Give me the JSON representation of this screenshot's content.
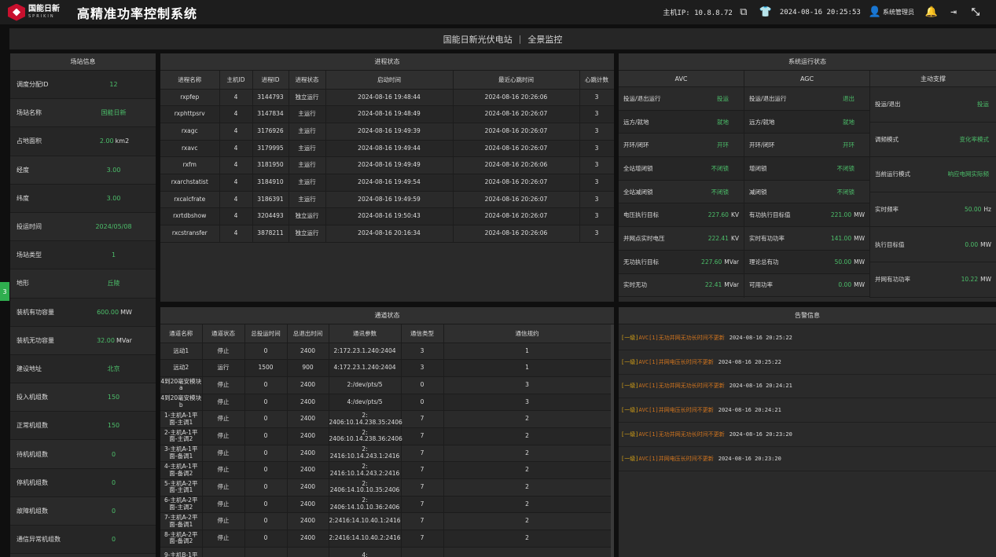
{
  "header": {
    "logo_cn": "国能日新",
    "logo_en": "SPRIKIN",
    "title": "高精准功率控制系统",
    "host_ip": "主机IP: 10.8.8.72",
    "datetime": "2024-08-16 20:25:53",
    "user": "系统管理员"
  },
  "station": {
    "name": "国能日新光伏电站",
    "view": "全景监控"
  },
  "side_tab": "3",
  "site_info": {
    "title": "场站信息",
    "rows": [
      {
        "k": "调度分配ID",
        "v": "12",
        "u": ""
      },
      {
        "k": "场站名称",
        "v": "国能日新",
        "u": ""
      },
      {
        "k": "占地面积",
        "v": "2.00",
        "u": "km2"
      },
      {
        "k": "经度",
        "v": "3.00",
        "u": ""
      },
      {
        "k": "纬度",
        "v": "3.00",
        "u": ""
      },
      {
        "k": "投运时间",
        "v": "2024/05/08",
        "u": ""
      },
      {
        "k": "场站类型",
        "v": "1",
        "u": ""
      },
      {
        "k": "地形",
        "v": "丘陵",
        "u": ""
      },
      {
        "k": "装机有功容量",
        "v": "600.00",
        "u": "MW"
      },
      {
        "k": "装机无功容量",
        "v": "32.00",
        "u": "MVar"
      },
      {
        "k": "建设地址",
        "v": "北京",
        "u": ""
      },
      {
        "k": "投入机组数",
        "v": "150",
        "u": ""
      },
      {
        "k": "正常机组数",
        "v": "150",
        "u": ""
      },
      {
        "k": "待机机组数",
        "v": "0",
        "u": ""
      },
      {
        "k": "停机机组数",
        "v": "0",
        "u": ""
      },
      {
        "k": "故障机组数",
        "v": "0",
        "u": ""
      },
      {
        "k": "通信异常机组数",
        "v": "0",
        "u": ""
      }
    ]
  },
  "process": {
    "title": "进程状态",
    "headers": [
      "进程名称",
      "主机ID",
      "进程ID",
      "进程状态",
      "启动时间",
      "最近心跳时间",
      "心跳计数"
    ],
    "rows": [
      [
        "rxpfep",
        "4",
        "3144793",
        "独立运行",
        "2024-08-16 19:48:44",
        "2024-08-16 20:26:06",
        "3"
      ],
      [
        "rxphttpsrv",
        "4",
        "3147834",
        "主运行",
        "2024-08-16 19:48:49",
        "2024-08-16 20:26:07",
        "3"
      ],
      [
        "rxagc",
        "4",
        "3176926",
        "主运行",
        "2024-08-16 19:49:39",
        "2024-08-16 20:26:07",
        "3"
      ],
      [
        "rxavc",
        "4",
        "3179995",
        "主运行",
        "2024-08-16 19:49:44",
        "2024-08-16 20:26:07",
        "3"
      ],
      [
        "rxfm",
        "4",
        "3181950",
        "主运行",
        "2024-08-16 19:49:49",
        "2024-08-16 20:26:06",
        "3"
      ],
      [
        "rxarchstatist",
        "4",
        "3184910",
        "主运行",
        "2024-08-16 19:49:54",
        "2024-08-16 20:26:07",
        "3"
      ],
      [
        "rxcalcfrate",
        "4",
        "3186391",
        "主运行",
        "2024-08-16 19:49:59",
        "2024-08-16 20:26:07",
        "3"
      ],
      [
        "rxrtdbshow",
        "4",
        "3204493",
        "独立运行",
        "2024-08-16 19:50:43",
        "2024-08-16 20:26:07",
        "3"
      ],
      [
        "rxcstransfer",
        "4",
        "3878211",
        "独立运行",
        "2024-08-16 20:16:34",
        "2024-08-16 20:26:06",
        "3"
      ]
    ]
  },
  "channel": {
    "title": "通道状态",
    "headers": [
      "通道名称",
      "通道状态",
      "总投运时间",
      "总退出时间",
      "通讯参数",
      "通信类型",
      "通信规约"
    ],
    "rows": [
      [
        "远动1",
        "停止",
        "0",
        "2400",
        "2:172.23.1.240:2404",
        "3",
        "1"
      ],
      [
        "远动2",
        "运行",
        "1500",
        "900",
        "4:172.23.1.240:2404",
        "3",
        "1"
      ],
      [
        "4到20毫安模块a",
        "停止",
        "0",
        "2400",
        "2:/dev/pts/5",
        "0",
        "3"
      ],
      [
        "4到20毫安模块b",
        "停止",
        "0",
        "2400",
        "4:/dev/pts/5",
        "0",
        "3"
      ],
      [
        "1-主机A-1平面-主调1",
        "停止",
        "0",
        "2400",
        "2: 2406:10.14.238.35:2406",
        "7",
        "2"
      ],
      [
        "2-主机A-1平面-主调2",
        "停止",
        "0",
        "2400",
        "2: 2406:10.14.238.36:2406",
        "7",
        "2"
      ],
      [
        "3-主机A-1平面-备调1",
        "停止",
        "0",
        "2400",
        "2: 2416:10.14.243.1:2416",
        "7",
        "2"
      ],
      [
        "4-主机A-1平面-备调2",
        "停止",
        "0",
        "2400",
        "2: 2416:10.14.243.2:2416",
        "7",
        "2"
      ],
      [
        "5-主机A-2平面-主调1",
        "停止",
        "0",
        "2400",
        "2: 2406:14.10.10.35:2406",
        "7",
        "2"
      ],
      [
        "6-主机A-2平面-主调2",
        "停止",
        "0",
        "2400",
        "2: 2406:14.10.10.36:2406",
        "7",
        "2"
      ],
      [
        "7-主机A-2平面-备调1",
        "停止",
        "0",
        "2400",
        "2:2416:14.10.40.1:2416",
        "7",
        "2"
      ],
      [
        "8-主机A-2平面-备调2",
        "停止",
        "0",
        "2400",
        "2:2416:14.10.40.2:2416",
        "7",
        "2"
      ],
      [
        "9-主机B-1平",
        "",
        "",
        "",
        "4:",
        "",
        ""
      ]
    ]
  },
  "sys_status": {
    "title": "系统运行状态",
    "avc": {
      "label": "AVC",
      "rows": [
        {
          "k": "投运/退出运行",
          "v": "投运",
          "u": ""
        },
        {
          "k": "远方/就地",
          "v": "就地",
          "u": ""
        },
        {
          "k": "开环/闭环",
          "v": "开环",
          "u": ""
        },
        {
          "k": "全站增闭锁",
          "v": "不闭锁",
          "u": ""
        },
        {
          "k": "全站减闭锁",
          "v": "不闭锁",
          "u": ""
        },
        {
          "k": "电压执行目标",
          "v": "227.60",
          "u": "KV"
        },
        {
          "k": "并网点实时电压",
          "v": "222.41",
          "u": "KV"
        },
        {
          "k": "无功执行目标",
          "v": "227.60",
          "u": "MVar"
        },
        {
          "k": "实时无功",
          "v": "22.41",
          "u": "MVar"
        }
      ]
    },
    "agc": {
      "label": "AGC",
      "rows": [
        {
          "k": "投运/退出运行",
          "v": "退出",
          "u": ""
        },
        {
          "k": "远方/就地",
          "v": "就地",
          "u": ""
        },
        {
          "k": "开环/闭环",
          "v": "开环",
          "u": ""
        },
        {
          "k": "增闭锁",
          "v": "不闭锁",
          "u": ""
        },
        {
          "k": "减闭锁",
          "v": "不闭锁",
          "u": ""
        },
        {
          "k": "有功执行目标值",
          "v": "221.00",
          "u": "MW"
        },
        {
          "k": "实时有功功率",
          "v": "141.00",
          "u": "MW"
        },
        {
          "k": "理论总有功",
          "v": "50.00",
          "u": "MW"
        },
        {
          "k": "可用功率",
          "v": "0.00",
          "u": "MW"
        }
      ]
    },
    "active": {
      "label": "主动支撑",
      "rows": [
        {
          "k": "投运/退出",
          "v": "投运",
          "u": ""
        },
        {
          "k": "调频模式",
          "v": "变化率模式",
          "u": ""
        },
        {
          "k": "当前运行模式",
          "v": "响应电网实际频",
          "u": ""
        },
        {
          "k": "实时频率",
          "v": "50.00",
          "u": "Hz"
        },
        {
          "k": "执行目标值",
          "v": "0.00",
          "u": "MW"
        },
        {
          "k": "并网有功功率",
          "v": "10.22",
          "u": "MW"
        }
      ]
    }
  },
  "alarms": {
    "title": "告警信息",
    "items": [
      {
        "lvl": "[一级]",
        "msg": "AVC[1]无功并网无功长时间不更新",
        "ts": "2024-08-16 20:25:22"
      },
      {
        "lvl": "[一级]",
        "msg": "AVC[1]并网电压长时间不更新",
        "ts": "2024-08-16 20:25:22"
      },
      {
        "lvl": "[一级]",
        "msg": "AVC[1]无功并网无功长时间不更新",
        "ts": "2024-08-16 20:24:21"
      },
      {
        "lvl": "[一级]",
        "msg": "AVC[1]并网电压长时间不更新",
        "ts": "2024-08-16 20:24:21"
      },
      {
        "lvl": "[一级]",
        "msg": "AVC[1]无功并网无功长时间不更新",
        "ts": "2024-08-16 20:23:20"
      },
      {
        "lvl": "[一级]",
        "msg": "AVC[1]并网电压长时间不更新",
        "ts": "2024-08-16 20:23:20"
      }
    ]
  }
}
